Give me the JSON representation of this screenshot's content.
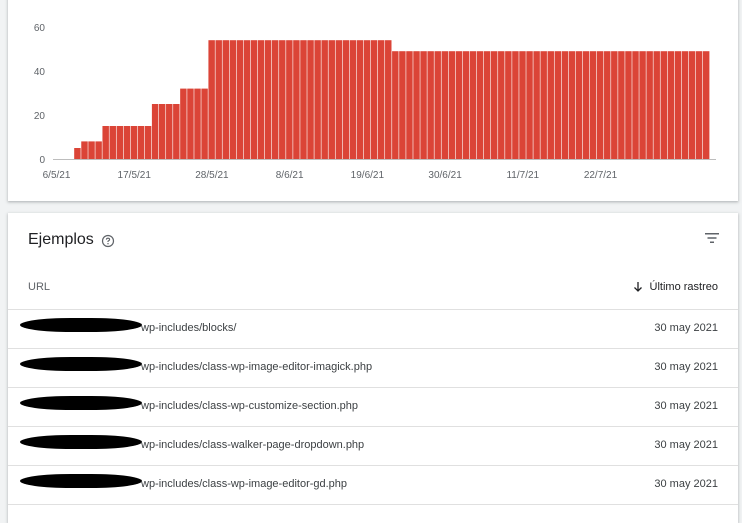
{
  "chart_data": {
    "type": "bar",
    "color": "#db4437",
    "ylim": [
      0,
      60
    ],
    "yticks": [
      "0",
      "20",
      "40",
      "60"
    ],
    "xtick_labels": [
      "6/5/21",
      "17/5/21",
      "28/5/21",
      "8/6/21",
      "19/6/21",
      "30/6/21",
      "11/7/21",
      "22/7/21"
    ],
    "categories": [
      "6/5/21",
      "7/5/21",
      "8/5/21",
      "9/5/21",
      "10/5/21",
      "11/5/21",
      "12/5/21",
      "13/5/21",
      "14/5/21",
      "15/5/21",
      "16/5/21",
      "17/5/21",
      "18/5/21",
      "19/5/21",
      "20/5/21",
      "21/5/21",
      "22/5/21",
      "23/5/21",
      "24/5/21",
      "25/5/21",
      "26/5/21",
      "27/5/21",
      "28/5/21",
      "29/5/21",
      "30/5/21",
      "31/5/21",
      "1/6/21",
      "2/6/21",
      "3/6/21",
      "4/6/21",
      "5/6/21",
      "6/6/21",
      "7/6/21",
      "8/6/21",
      "9/6/21",
      "10/6/21",
      "11/6/21",
      "12/6/21",
      "13/6/21",
      "14/6/21",
      "15/6/21",
      "16/6/21",
      "17/6/21",
      "18/6/21",
      "19/6/21",
      "20/6/21",
      "21/6/21",
      "22/6/21",
      "23/6/21",
      "24/6/21",
      "25/6/21",
      "26/6/21",
      "27/6/21",
      "28/6/21",
      "29/6/21",
      "30/6/21",
      "1/7/21",
      "2/7/21",
      "3/7/21",
      "4/7/21",
      "5/7/21",
      "6/7/21",
      "7/7/21",
      "8/7/21",
      "9/7/21",
      "10/7/21",
      "11/7/21",
      "12/7/21",
      "13/7/21",
      "14/7/21",
      "15/7/21",
      "16/7/21",
      "17/7/21",
      "18/7/21",
      "19/7/21",
      "20/7/21",
      "21/7/21",
      "22/7/21",
      "23/7/21",
      "24/7/21",
      "25/7/21",
      "26/7/21",
      "27/7/21",
      "28/7/21",
      "29/7/21",
      "30/7/21",
      "31/7/21",
      "1/8/21",
      "2/8/21",
      "3/8/21",
      "4/8/21",
      "5/8/21"
    ],
    "values": [
      0,
      0,
      0,
      5,
      8,
      8,
      8,
      15,
      15,
      15,
      15,
      15,
      15,
      15,
      25,
      25,
      25,
      25,
      32,
      32,
      32,
      32,
      54,
      54,
      54,
      54,
      54,
      54,
      54,
      54,
      54,
      54,
      54,
      54,
      54,
      54,
      54,
      54,
      54,
      54,
      54,
      54,
      54,
      54,
      54,
      54,
      54,
      54,
      49,
      49,
      49,
      49,
      49,
      49,
      49,
      49,
      49,
      49,
      49,
      49,
      49,
      49,
      49,
      49,
      49,
      49,
      49,
      49,
      49,
      49,
      49,
      49,
      49,
      49,
      49,
      49,
      49,
      49,
      49,
      49,
      49,
      49,
      49,
      49,
      49,
      49,
      49,
      49,
      49,
      49,
      49,
      49,
      49
    ]
  },
  "examples": {
    "title": "Ejemplos",
    "help_icon": "help-circle-icon",
    "filter_icon": "filter-icon",
    "columns": {
      "url": "URL",
      "last_crawl": "Último rastreo",
      "sort_icon": "arrow-down-icon"
    },
    "rows": [
      {
        "url": "wp-includes/blocks/",
        "date": "30 may 2021"
      },
      {
        "url": "wp-includes/class-wp-image-editor-imagick.php",
        "date": "30 may 2021"
      },
      {
        "url": "wp-includes/class-wp-customize-section.php",
        "date": "30 may 2021"
      },
      {
        "url": "wp-includes/class-walker-page-dropdown.php",
        "date": "30 may 2021"
      },
      {
        "url": "wp-includes/class-wp-image-editor-gd.php",
        "date": "30 may 2021"
      }
    ]
  }
}
